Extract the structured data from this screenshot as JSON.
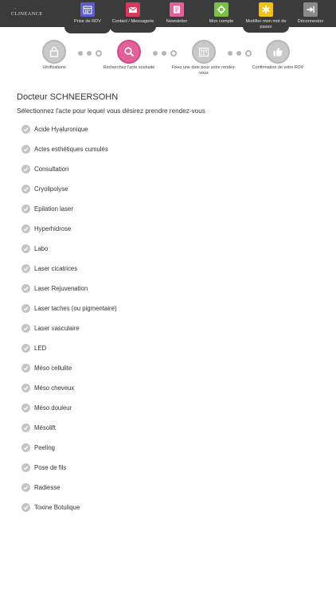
{
  "brand": {
    "mark": "~",
    "name": "CLINEANCE"
  },
  "nav": [
    {
      "label": "Prise de RDV",
      "icon": "calendar-icon",
      "color": "#5b5fc7"
    },
    {
      "label": "Contact / Messagerie",
      "icon": "mail-icon",
      "color": "#d8395a"
    },
    {
      "label": "Newsletter",
      "icon": "newsletter-icon",
      "color": "#e3619a"
    },
    {
      "label": "Mon compte",
      "icon": "gear-icon",
      "color": "#7cc043"
    },
    {
      "label": "Modifier mon mot de passe",
      "icon": "asterisk-icon",
      "color": "#f3c312"
    },
    {
      "label": "Déconnexion",
      "icon": "logout-icon",
      "color": "#8a8a8a"
    }
  ],
  "steps": [
    {
      "label": "Vérifications",
      "icon": "lock-icon"
    },
    {
      "label": "Recherchez l'acte souhaité",
      "icon": "search-icon"
    },
    {
      "label": "Fixez une date pour votre rendez-vous",
      "icon": "calendar-icon"
    },
    {
      "label": "Confirmation de votre RDV",
      "icon": "thumbs-up-icon"
    }
  ],
  "doctor_name": "Docteur SCHNEERSOHN",
  "instruction": "Sélectionnez l'acte pour lequel vous désirez prendre rendez-vous",
  "acts": [
    "Acide Hyaluronique",
    "Actes esthétiques cumulés",
    "Consultation",
    "Cryolipolyse",
    "Epilation laser",
    "Hyperhidrose",
    "Labo",
    "Laser cicatrices",
    "Laser Rejuvenation",
    "Laser taches (ou pigmentaire)",
    "Laser vasculaire",
    "LED",
    "Méso cellulite",
    "Méso cheveux",
    "Méso douleur",
    "Mésolift",
    "Peeling",
    "Pose de fils",
    "Radiesse",
    "Toxine Botulique"
  ],
  "colors": {
    "active_step": "#e3619a",
    "inactive_step": "#c9c9c9",
    "topbar": "#3b3b3b"
  }
}
